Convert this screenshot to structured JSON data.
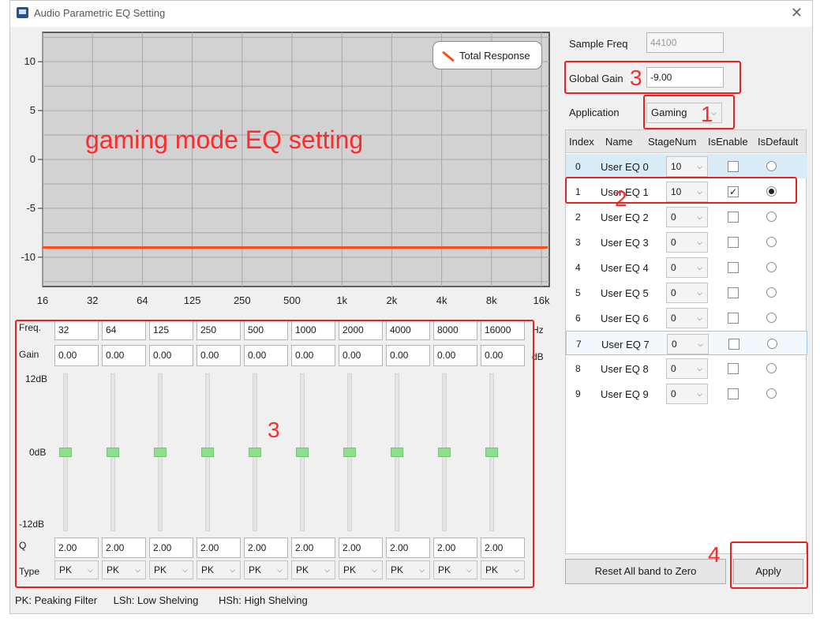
{
  "window": {
    "title": "Audio Parametric EQ Setting",
    "close": "✕"
  },
  "chart_data": {
    "type": "line",
    "title": "",
    "legend": [
      "Total Response"
    ],
    "legend_position": "top-right",
    "x_ticks": [
      "16",
      "32",
      "64",
      "125",
      "250",
      "500",
      "1k",
      "2k",
      "4k",
      "8k",
      "16k"
    ],
    "y_ticks": [
      "10",
      "5",
      "0",
      "-5",
      "-10"
    ],
    "ylim": [
      -13,
      13
    ],
    "series": [
      {
        "name": "Total Response",
        "x": [
          16,
          16000
        ],
        "y": [
          -9,
          -9
        ],
        "color": "#ff4a1c"
      }
    ],
    "grid": true
  },
  "annotations": {
    "gaming_text": "gaming mode EQ setting",
    "num1": "1",
    "num2": "2",
    "num3a": "3",
    "num3b": "3",
    "num4": "4",
    "color": "#e52222"
  },
  "bands": {
    "freq_label": "Freq.",
    "gain_label": "Gain",
    "q_label": "Q",
    "type_label": "Type",
    "freq_unit": "Hz",
    "gain_unit": "dB",
    "max_label": "12dB",
    "mid_label": "0dB",
    "min_label": "-12dB",
    "freqs": [
      "32",
      "64",
      "125",
      "250",
      "500",
      "1000",
      "2000",
      "4000",
      "8000",
      "16000"
    ],
    "gains": [
      "0.00",
      "0.00",
      "0.00",
      "0.00",
      "0.00",
      "0.00",
      "0.00",
      "0.00",
      "0.00",
      "0.00"
    ],
    "qs": [
      "2.00",
      "2.00",
      "2.00",
      "2.00",
      "2.00",
      "2.00",
      "2.00",
      "2.00",
      "2.00",
      "2.00"
    ],
    "types": [
      "PK",
      "PK",
      "PK",
      "PK",
      "PK",
      "PK",
      "PK",
      "PK",
      "PK",
      "PK"
    ],
    "slider_levels_db": [
      0,
      0,
      0,
      0,
      0,
      0,
      0,
      0,
      0,
      0
    ]
  },
  "legend_note": {
    "pk": "PK: Peaking Filter",
    "lsh": "LSh: Low Shelving",
    "hsh": "HSh: High Shelving"
  },
  "settings": {
    "sample_freq_label": "Sample Freq",
    "sample_freq_value": "44100",
    "global_gain_label": "Global Gain",
    "global_gain_value": "-9.00",
    "application_label": "Application",
    "application_value": "Gaming"
  },
  "table": {
    "headers": [
      "Index",
      "Name",
      "StageNum",
      "IsEnable",
      "IsDefault"
    ],
    "rows": [
      {
        "index": "0",
        "name": "User EQ 0",
        "stage": "10",
        "enabled": false,
        "default": false
      },
      {
        "index": "1",
        "name": "User EQ 1",
        "stage": "10",
        "enabled": true,
        "default": true
      },
      {
        "index": "2",
        "name": "User EQ 2",
        "stage": "0",
        "enabled": false,
        "default": false
      },
      {
        "index": "3",
        "name": "User EQ 3",
        "stage": "0",
        "enabled": false,
        "default": false
      },
      {
        "index": "4",
        "name": "User EQ 4",
        "stage": "0",
        "enabled": false,
        "default": false
      },
      {
        "index": "5",
        "name": "User EQ 5",
        "stage": "0",
        "enabled": false,
        "default": false
      },
      {
        "index": "6",
        "name": "User EQ 6",
        "stage": "0",
        "enabled": false,
        "default": false
      },
      {
        "index": "7",
        "name": "User EQ 7",
        "stage": "0",
        "enabled": false,
        "default": false
      },
      {
        "index": "8",
        "name": "User EQ 8",
        "stage": "0",
        "enabled": false,
        "default": false
      },
      {
        "index": "9",
        "name": "User EQ 9",
        "stage": "0",
        "enabled": false,
        "default": false
      }
    ]
  },
  "buttons": {
    "reset": "Reset All band to Zero",
    "apply": "Apply"
  },
  "colors": {
    "plot_bg": "#d2d2d2",
    "response": "#ff4a1c",
    "slider_thumb": "#8ee08e",
    "row_selected": "#d9ebf7"
  }
}
